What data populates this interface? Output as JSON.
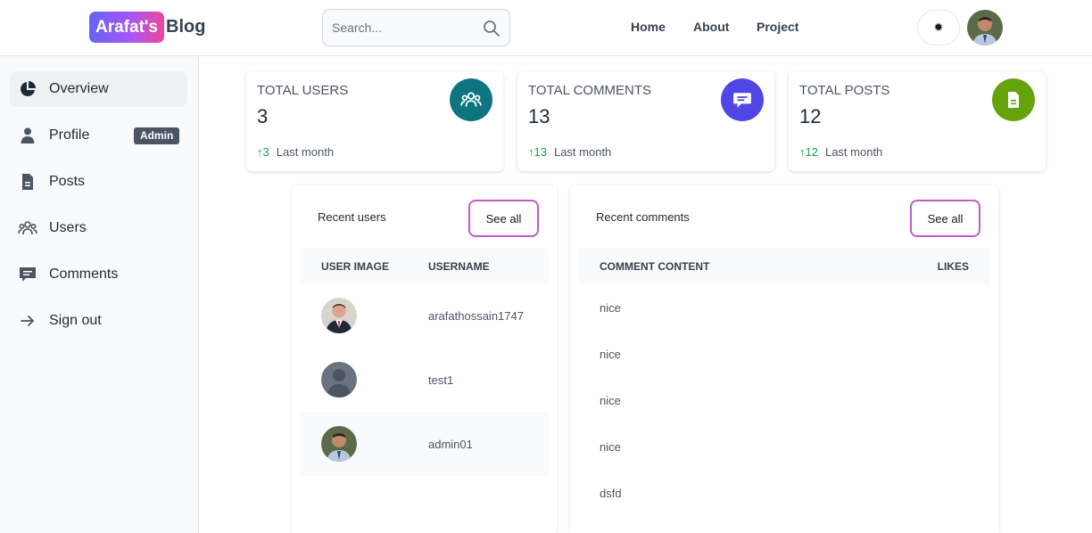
{
  "header": {
    "logo_badge": "Arafat's",
    "logo_text": "Blog",
    "search_placeholder": "Search...",
    "nav": [
      "Home",
      "About",
      "Project"
    ],
    "theme_icon": "sun-icon"
  },
  "sidebar": {
    "items": [
      {
        "label": "Overview",
        "icon": "pie-chart-icon",
        "active": true
      },
      {
        "label": "Profile",
        "icon": "user-icon",
        "badge": "Admin"
      },
      {
        "label": "Posts",
        "icon": "document-icon"
      },
      {
        "label": "Users",
        "icon": "users-group-icon"
      },
      {
        "label": "Comments",
        "icon": "comment-icon"
      },
      {
        "label": "Sign out",
        "icon": "arrow-right-icon"
      }
    ]
  },
  "stats": [
    {
      "title": "Total Users",
      "value": "3",
      "delta": "3",
      "period": "Last month",
      "color": "#0e7480"
    },
    {
      "title": "Total Comments",
      "value": "13",
      "delta": "13",
      "period": "Last month",
      "color": "#4f46e5"
    },
    {
      "title": "Total Posts",
      "value": "12",
      "delta": "12",
      "period": "Last month",
      "color": "#65a30d"
    }
  ],
  "recent_users": {
    "title": "Recent users",
    "see_all": "See all",
    "columns": [
      "User image",
      "Username"
    ],
    "rows": [
      "arafathossain1747",
      "test1",
      "admin01"
    ]
  },
  "recent_comments": {
    "title": "Recent comments",
    "see_all": "See all",
    "columns": [
      "Comment content",
      "Likes"
    ],
    "rows": [
      "nice",
      "nice",
      "nice",
      "nice",
      "dsfd"
    ]
  },
  "colors": {
    "accent_gradient_start": "#6366f1",
    "accent_gradient_end": "#ec4899",
    "up_arrow": "#16a34a"
  }
}
